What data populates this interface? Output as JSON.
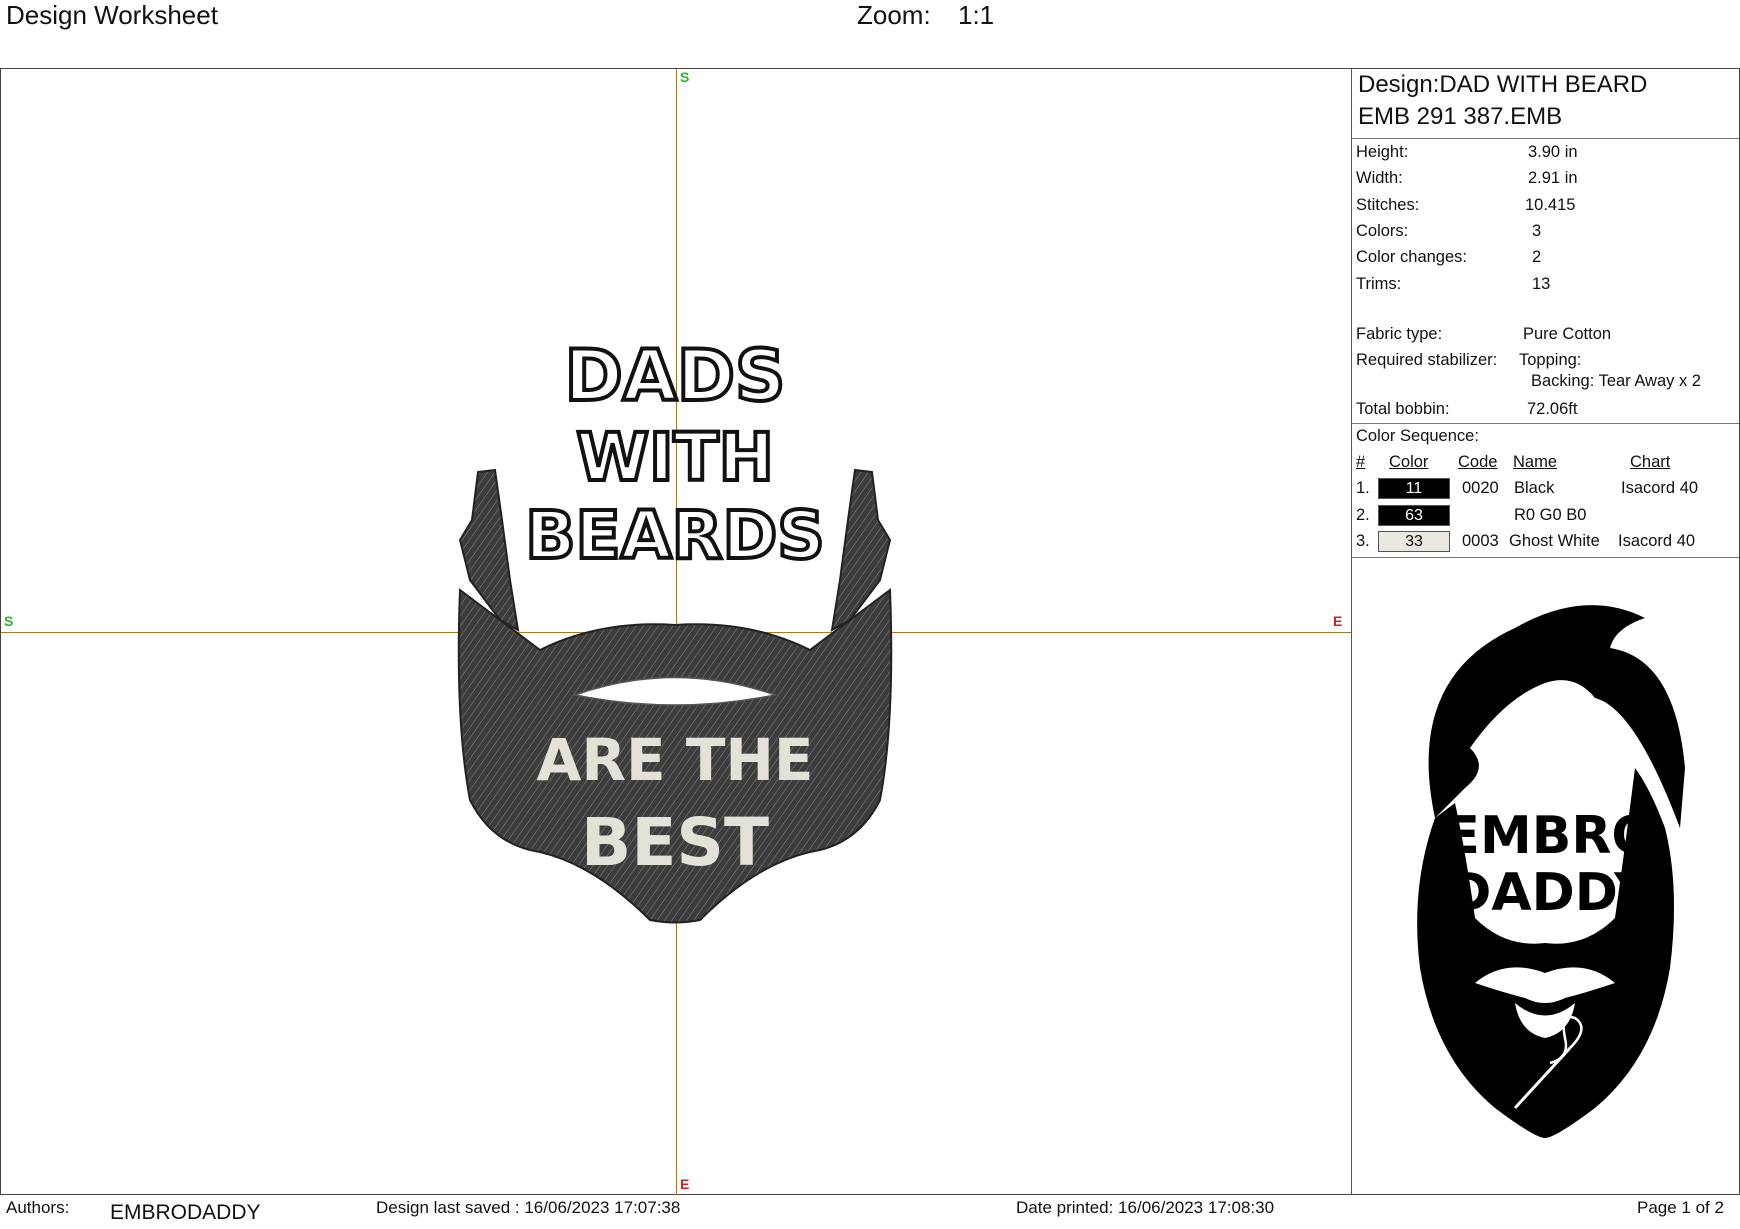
{
  "header": {
    "title": "Design Worksheet",
    "zoom_label": "Zoom:",
    "zoom_value": "1:1"
  },
  "axis": {
    "start": "S",
    "end": "E"
  },
  "design": {
    "title_line1": "Design:DAD WITH BEARD",
    "title_line2": "EMB 291 387.EMB",
    "specs": [
      {
        "label": "Height:",
        "value": "3.90 in"
      },
      {
        "label": "Width:",
        "value": "2.91 in"
      },
      {
        "label": "Stitches:",
        "value": "10.415"
      },
      {
        "label": "Colors:",
        "value": "3"
      },
      {
        "label": "Color changes:",
        "value": "2"
      },
      {
        "label": "Trims:",
        "value": "13"
      }
    ],
    "fabric_label": "Fabric type:",
    "fabric_value": "Pure Cotton",
    "stabilizer_label": "Required stabilizer:",
    "topping": "Topping:",
    "backing": "Backing: Tear Away x 2",
    "bobbin_label": "Total bobbin:",
    "bobbin_value": "72.06ft"
  },
  "color_sequence": {
    "title": "Color Sequence:",
    "headers": {
      "num": "#",
      "color": "Color",
      "code": "Code",
      "name": "Name",
      "chart": "Chart"
    },
    "rows": [
      {
        "num": "1.",
        "swatch": "11",
        "code": "0020",
        "name": "Black",
        "chart": "Isacord 40",
        "bg": "#000000",
        "fg": "#ffffff"
      },
      {
        "num": "2.",
        "swatch": "63",
        "code": "",
        "name": "R0 G0 B0",
        "chart": "",
        "bg": "#000000",
        "fg": "#ffffff"
      },
      {
        "num": "3.",
        "swatch": "33",
        "code": "0003",
        "name": "Ghost White",
        "chart": "Isacord 40",
        "bg": "#e9e7df",
        "fg": "#111111"
      }
    ]
  },
  "preview": {
    "line1": "DADS",
    "line2": "WITH",
    "line3": "BEARDS",
    "line4": "ARE THE",
    "line5": "BEST"
  },
  "logo": {
    "line1": "EMBRO",
    "line2": "DADDY"
  },
  "footer": {
    "authors_label": "Authors:",
    "authors_value": "EMBRODADDY",
    "saved": "Design last saved : 16/06/2023 17:07:38",
    "printed": "Date printed: 16/06/2023 17:08:30",
    "page": "Page 1 of 2"
  }
}
